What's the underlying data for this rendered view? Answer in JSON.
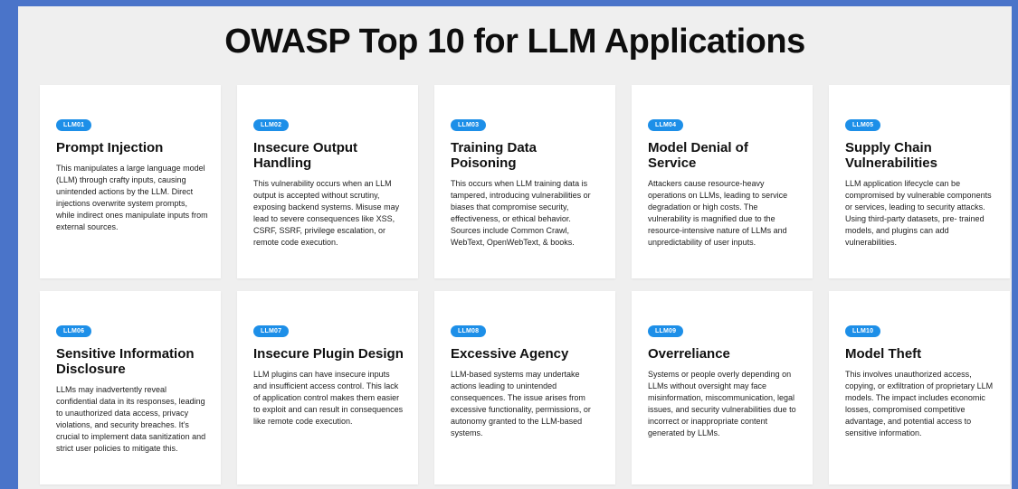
{
  "page": {
    "title": "OWASP Top 10 for LLM Applications"
  },
  "colors": {
    "background": "#4a74c9",
    "panel": "#efefef",
    "badge": "#1d8fe8",
    "card": "#ffffff"
  },
  "cards": [
    {
      "id": "LLM01",
      "title": "Prompt Injection",
      "description": "This manipulates a large language model (LLM) through crafty inputs, causing unintended actions by the LLM. Direct injections overwrite system prompts, while indirect ones manipulate inputs from external sources."
    },
    {
      "id": "LLM02",
      "title": "Insecure Output Handling",
      "description": "This vulnerability occurs when an LLM output is accepted without scrutiny, exposing backend systems. Misuse may lead to severe consequences like XSS, CSRF, SSRF, privilege escalation, or remote code execution."
    },
    {
      "id": "LLM03",
      "title": "Training Data Poisoning",
      "description": "This occurs when LLM training data is tampered, introducing vulnerabilities or biases that compromise security, effectiveness, or ethical behavior. Sources include Common Crawl, WebText, OpenWebText, & books."
    },
    {
      "id": "LLM04",
      "title": "Model Denial of Service",
      "description": "Attackers cause resource-heavy operations on LLMs, leading to service degradation or high costs. The vulnerability is magnified due to the resource-intensive nature of LLMs and unpredictability of user inputs."
    },
    {
      "id": "LLM05",
      "title": "Supply Chain Vulnerabilities",
      "description": "LLM application lifecycle can be compromised by vulnerable components or services, leading to security attacks. Using third-party datasets, pre- trained models, and plugins can add vulnerabilities."
    },
    {
      "id": "LLM06",
      "title": "Sensitive Information Disclosure",
      "description": "LLMs may inadvertently reveal confidential data in its responses, leading to unauthorized data access, privacy violations, and security breaches. It’s crucial to implement data sanitization and strict user policies to mitigate this."
    },
    {
      "id": "LLM07",
      "title": "Insecure Plugin Design",
      "description": "LLM plugins can have insecure inputs and insufficient access control. This lack of application control makes them easier to exploit and can result in consequences like remote code execution."
    },
    {
      "id": "LLM08",
      "title": "Excessive Agency",
      "description": "LLM-based systems may undertake actions leading to unintended consequences. The issue arises from excessive functionality, permissions, or autonomy granted to the LLM-based systems."
    },
    {
      "id": "LLM09",
      "title": "Overreliance",
      "description": "Systems or people overly depending on LLMs without oversight may face misinformation, miscommunication, legal issues, and security vulnerabilities due to incorrect or inappropriate content generated by LLMs."
    },
    {
      "id": "LLM10",
      "title": "Model Theft",
      "description": "This involves unauthorized access, copying, or exfiltration of proprietary LLM models. The impact includes economic losses, compromised competitive advantage, and potential access to sensitive information."
    }
  ]
}
